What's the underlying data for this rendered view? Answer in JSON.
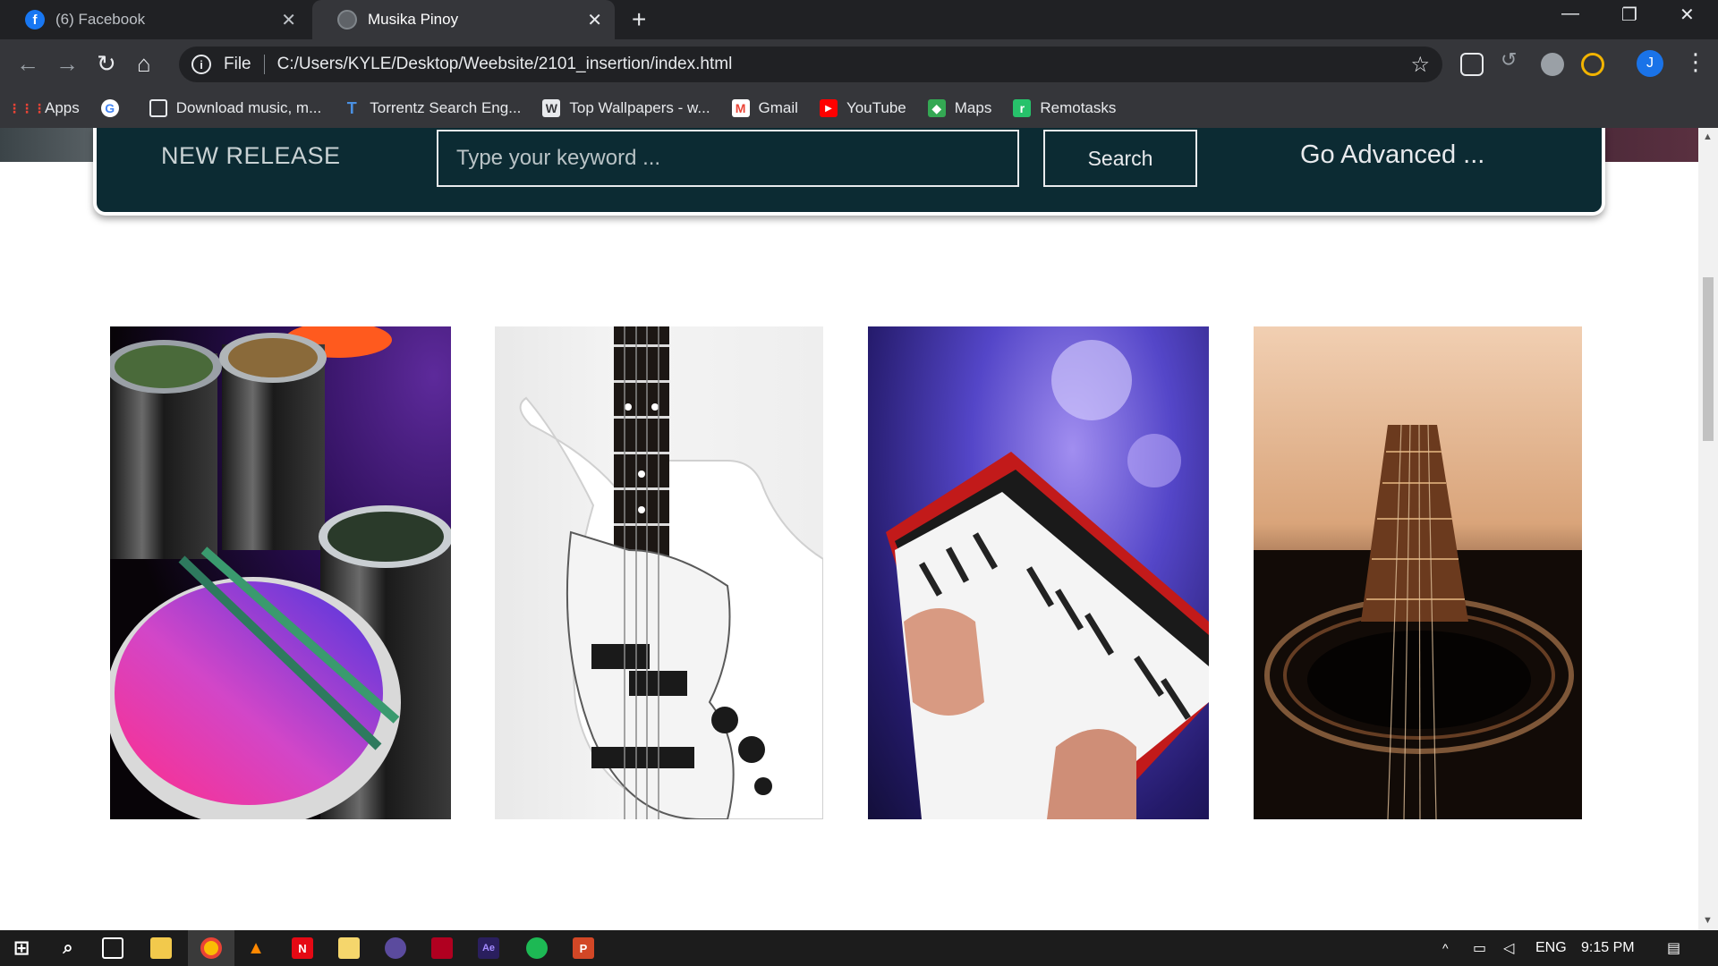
{
  "browser": {
    "tabs": [
      {
        "title": "(6) Facebook",
        "icon": "facebook-icon",
        "active": false
      },
      {
        "title": "Musika Pinoy",
        "icon": "globe-icon",
        "active": true
      }
    ],
    "new_tab": "+",
    "address": {
      "scheme_label": "File",
      "url": "C:/Users/KYLE/Desktop/Weebsite/2101_insertion/index.html"
    },
    "profile_initial": "J"
  },
  "bookmarks": [
    {
      "label": "Apps",
      "icon": "apps-grid-icon"
    },
    {
      "label": "",
      "icon": "google-icon"
    },
    {
      "label": "Download music, m...",
      "icon": "download-music-icon"
    },
    {
      "label": "Torrentz Search Eng...",
      "icon": "torrentz-icon"
    },
    {
      "label": "Top Wallpapers - w...",
      "icon": "wallpapers-icon"
    },
    {
      "label": "Gmail",
      "icon": "gmail-icon"
    },
    {
      "label": "YouTube",
      "icon": "youtube-icon"
    },
    {
      "label": "Maps",
      "icon": "maps-icon"
    },
    {
      "label": "Remotasks",
      "icon": "remotasks-icon"
    }
  ],
  "page": {
    "panel": {
      "new_release": "NEW RELEASE",
      "search_placeholder": "Type your keyword ...",
      "search_button": "Search",
      "advanced_link": "Go Advanced ..."
    },
    "images": [
      {
        "subject": "drums"
      },
      {
        "subject": "bass-guitar"
      },
      {
        "subject": "keyboard"
      },
      {
        "subject": "acoustic-guitar"
      }
    ]
  },
  "taskbar": {
    "language": "ENG",
    "time": "9:15 PM"
  },
  "colors": {
    "panel_bg": "#0c2b33",
    "chrome_dark": "#202124",
    "chrome_toolbar": "#35363a"
  }
}
